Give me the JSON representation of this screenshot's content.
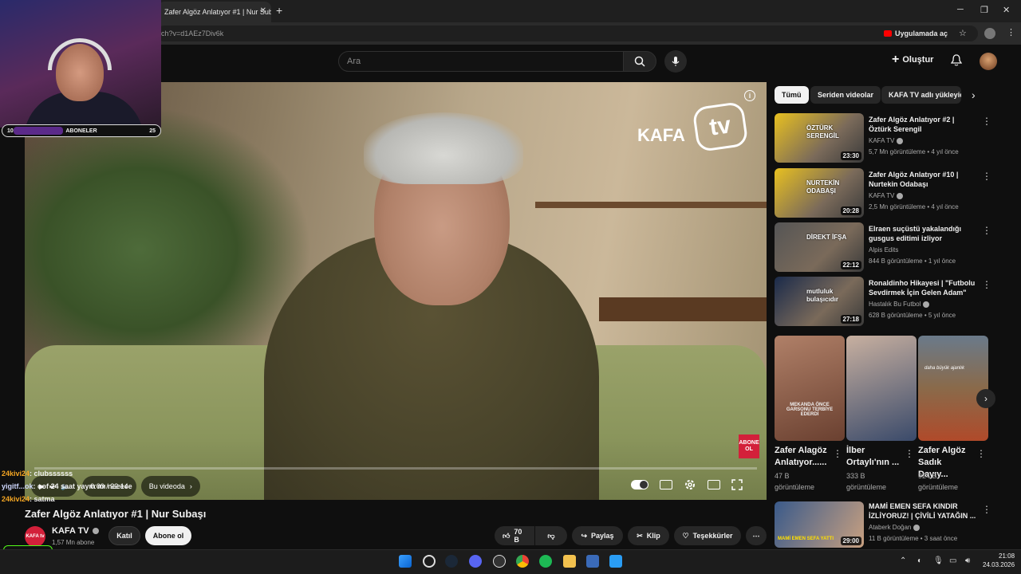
{
  "browser": {
    "tab_title": "Zafer Algöz Anlatıyor #1 | Nur Subaşı - YouTube",
    "url_fragment": "ch?v=d1AEz7Div6k",
    "open_in_app": "Uygulamada aç"
  },
  "header": {
    "search_placeholder": "Ara",
    "create_label": "Oluştur"
  },
  "video": {
    "title": "Zafer Algöz Anlatıyor #1 | Nur Subaşı",
    "time": "0:00 / 22:14",
    "chapter_label": "Bu videoda",
    "logo_text_kafa": "KAFA",
    "logo_text_tv": "tv",
    "sub_badge": "ABONE OL"
  },
  "channel": {
    "name": "KAFA TV",
    "avatar_text": "KAFA tv",
    "subscribers": "1,57 Mn abone",
    "join_label": "Katıl",
    "subscribe_label": "Abone ol"
  },
  "actions": {
    "likes": "70 B",
    "share": "Paylaş",
    "clip": "Klip",
    "thanks": "Teşekkürler"
  },
  "chips": [
    "Tümü",
    "Seriden videolar",
    "KAFA TV adlı yükleyic"
  ],
  "recommendations": [
    {
      "title": "Zafer Algöz Anlatıyor #2 | Öztürk Serengil",
      "channel": "KAFA TV",
      "verified": true,
      "meta": "5,7 Mn görüntüleme • 4 yıl önce",
      "duration": "23:30",
      "thumb_text": "ÖZTÜRK SERENGİL",
      "thumb_color": "#e8c020"
    },
    {
      "title": "Zafer Algöz Anlatıyor #10 | Nurtekin Odabaşı",
      "channel": "KAFA TV",
      "verified": true,
      "meta": "2,5 Mn görüntüleme • 4 yıl önce",
      "duration": "20:28",
      "thumb_text": "NURTEKİN ODABAŞI",
      "thumb_color": "#e8c020"
    },
    {
      "title": "Elraen suçüstü yakalandığı gusgus editimi izliyor",
      "channel": "Alpis Edits",
      "verified": false,
      "meta": "844 B görüntüleme • 1 yıl önce",
      "duration": "22:12",
      "thumb_text": "DİREKT İFŞA",
      "thumb_color": "#555555"
    },
    {
      "title": "Ronaldinho Hikayesi | \"Futbolu Sevdirmek İçin Gelen Adam\"",
      "channel": "Hastalık Bu Futbol",
      "verified": true,
      "meta": "628 B görüntüleme • 5 yıl önce",
      "duration": "27:18",
      "thumb_text": "mutluluk bulaşıcıdır",
      "thumb_color": "#1a2a4a"
    }
  ],
  "shorts": [
    {
      "title": "Zafer Alagöz Anlatıyor......",
      "views": "47 B görüntüleme",
      "overlay": "MEKANDA ÖNCE GARSONU TERBİYE EDERDİ"
    },
    {
      "title": "İlber Ortaylı'nın ...",
      "views": "333 B görüntüleme",
      "overlay": ""
    },
    {
      "title": "Zafer Algöz Sadık Dayıy...",
      "views": "924 B görüntüleme",
      "overlay": "daha büyük ajanlık"
    }
  ],
  "last_rec": {
    "title": "MAMİ EMEN SEFA KINDIR İZLİYORUZ! | ÇİVİLİ YATAĞIN ...",
    "channel": "Ataberk Doğan",
    "meta": "11 B görüntüleme • 3 saat önce",
    "duration": "29:00",
    "thumb_text": "MAMİ EMEN SEFA YATTI"
  },
  "stream_overlay": {
    "sub_goal_label": "ABONELER",
    "sub_goal_current": "10",
    "sub_goal_target": "25",
    "kick_count": "10",
    "chat": [
      {
        "user": "24kivi24",
        "msg": ": clubssssss"
      },
      {
        "user": "yigitf...ok",
        "msg": ": oof 24 saat yayın mı neeeee"
      },
      {
        "user": "24kivi24",
        "msg": ": satma"
      }
    ]
  },
  "taskbar": {
    "time": "21:08",
    "date": "24.03.2026"
  }
}
